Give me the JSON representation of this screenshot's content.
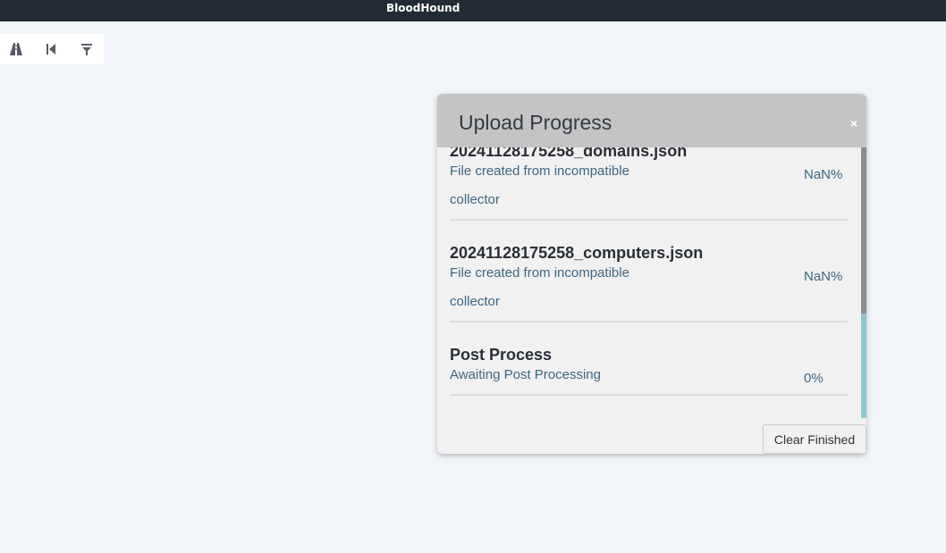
{
  "app": {
    "title": "BloodHound"
  },
  "toolbar": {
    "buttons": [
      {
        "icon": "path-icon"
      },
      {
        "icon": "back-icon"
      },
      {
        "icon": "filter-icon"
      }
    ]
  },
  "modal": {
    "title": "Upload Progress",
    "close_label": "×",
    "items": [
      {
        "name": "20241128175258_domains.json",
        "status": "File created from incompatible collector",
        "percent": "NaN%"
      },
      {
        "name": "20241128175258_computers.json",
        "status": "File created from incompatible collector",
        "percent": "NaN%"
      },
      {
        "name": "Post Process",
        "status": "Awaiting Post Processing",
        "percent": "0%"
      }
    ],
    "clear_button": "Clear Finished"
  },
  "colors": {
    "titlebar": "#232b36",
    "background": "#f1f4f8",
    "modal_header": "#c4c4c4",
    "status_text": "#3d6683",
    "scrollbar_track": "#8fc6ce"
  }
}
